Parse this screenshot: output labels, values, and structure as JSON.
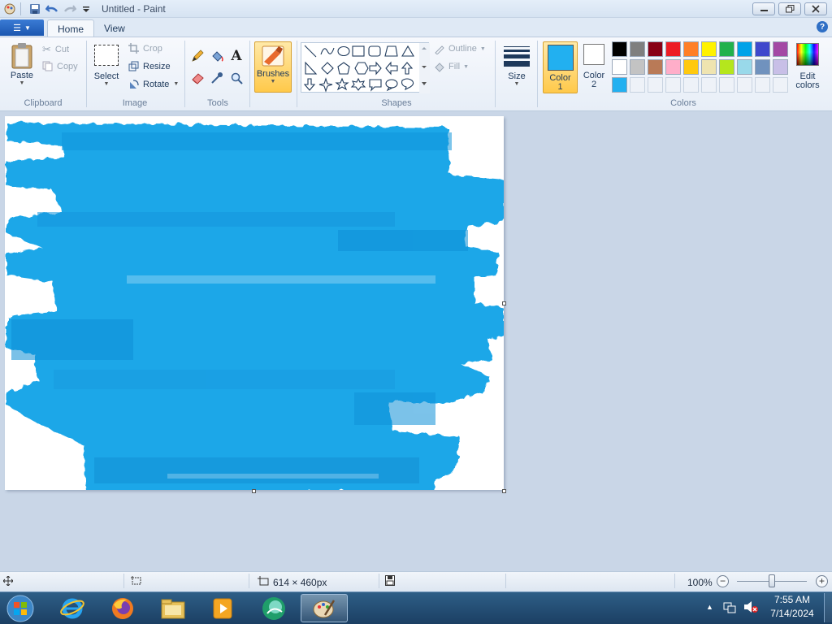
{
  "window": {
    "title": "Untitled - Paint"
  },
  "tabs": {
    "file_label": "☰",
    "home": "Home",
    "view": "View"
  },
  "clipboard": {
    "paste": "Paste",
    "cut": "Cut",
    "copy": "Copy",
    "group": "Clipboard"
  },
  "image": {
    "select": "Select",
    "crop": "Crop",
    "resize": "Resize",
    "rotate": "Rotate",
    "group": "Image"
  },
  "tools": {
    "group": "Tools",
    "text_tool": "A"
  },
  "brushes": {
    "label": "Brushes"
  },
  "shapes": {
    "outline": "Outline",
    "fill": "Fill",
    "group": "Shapes"
  },
  "size": {
    "label": "Size"
  },
  "colors": {
    "color1": "Color",
    "color1_num": "1",
    "color2": "Color",
    "color2_num": "2",
    "edit": "Edit",
    "edit2": "colors",
    "group": "Colors",
    "color1_value": "#22b0f0",
    "color2_value": "#ffffff",
    "palette_row1": [
      "#000000",
      "#7f7f7f",
      "#880015",
      "#ed1c24",
      "#ff7f27",
      "#fff200",
      "#22b14c",
      "#00a2e8",
      "#3f48cc",
      "#a349a4"
    ],
    "palette_row2": [
      "#ffffff",
      "#c3c3c3",
      "#b97a57",
      "#ffaec9",
      "#ffc90e",
      "#efe4b0",
      "#b5e61d",
      "#99d9ea",
      "#7092be",
      "#c8bfe7"
    ],
    "palette_row3": [
      "#22b0f0",
      "",
      "",
      "",
      "",
      "",
      "",
      "",
      "",
      ""
    ]
  },
  "status": {
    "canvas_size": "614 × 460px",
    "zoom": "100%"
  },
  "taskbar": {
    "time": "7:55 AM",
    "date": "7/14/2024"
  }
}
